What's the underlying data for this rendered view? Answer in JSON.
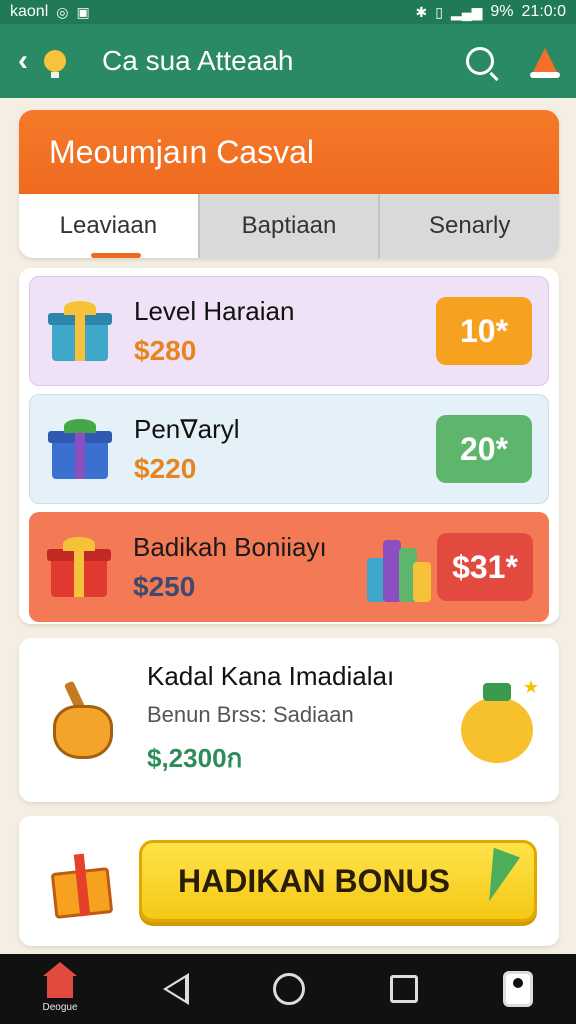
{
  "status_bar": {
    "carrier": "kaonl",
    "battery": "9%",
    "time": "21:0:0"
  },
  "app_bar": {
    "title": "Ca sua Atteaah",
    "icons": [
      "back-icon",
      "bulb-icon",
      "search-icon",
      "cone-icon"
    ]
  },
  "header": {
    "title": "Meoumjaın Casval",
    "tabs": [
      {
        "label": "Leaviaan",
        "active": true
      },
      {
        "label": "Baptiaan",
        "active": false
      },
      {
        "label": "Senarly",
        "active": false
      }
    ]
  },
  "rewards": [
    {
      "title": "Level Haraian",
      "price": "$280",
      "badge": "10*",
      "badge_color": "#f6a11f",
      "icon": "gift-blue-icon"
    },
    {
      "title": "Pen∇aryl",
      "price": "$220",
      "badge": "20*",
      "badge_color": "#5eb56c",
      "icon": "gift-purple-icon"
    },
    {
      "title": "Badikah Boniiayı",
      "price": "$250",
      "badge": "$31*",
      "badge_color": "#e24a3f",
      "icon": "gift-red-icon"
    }
  ],
  "info_card": {
    "title": "Kadal Kana Imadialaı",
    "subtitle": "Benun Brss: Sadiaan",
    "amount": "$,2300ก"
  },
  "bonus": {
    "button_label": "HADIKAN BONUS"
  },
  "nav": {
    "home_label": "Deogue"
  },
  "colors": {
    "brand_green": "#2a8a63",
    "accent_orange": "#ef6a1f",
    "bonus_yellow": "#f5c815"
  }
}
